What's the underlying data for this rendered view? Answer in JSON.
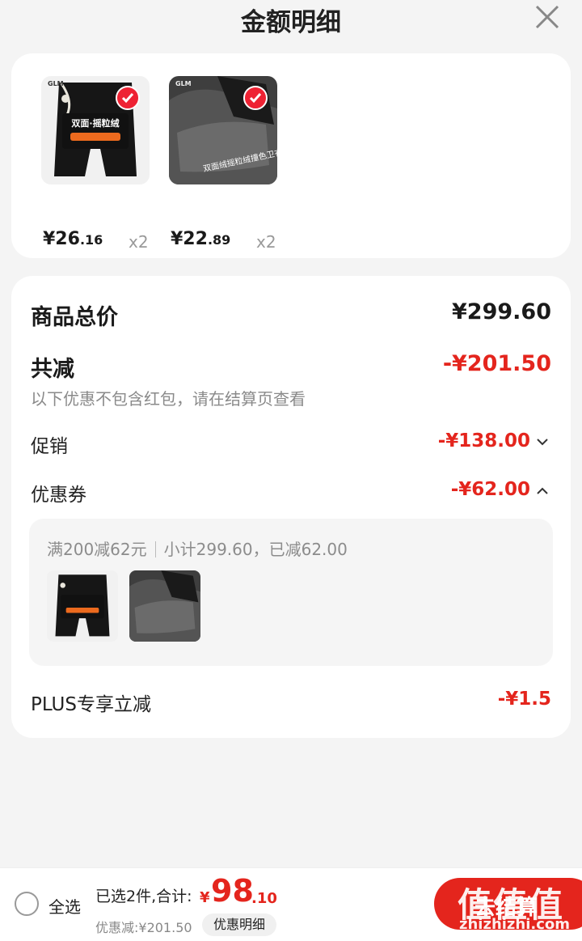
{
  "header": {
    "title": "金额明细"
  },
  "products": [
    {
      "thumb_text": "双面·摇粒绒",
      "brand": "GLM",
      "price_int": "¥26",
      "price_dec": ".16",
      "qty": "x2",
      "selected": true
    },
    {
      "thumb_text": "双面绒摇粒绒撞色卫衣",
      "brand": "GLM",
      "price_int": "¥22",
      "price_dec": ".89",
      "qty": "x2",
      "selected": true
    }
  ],
  "details": {
    "total_label": "商品总价",
    "total_value": "¥299.60",
    "discount_label": "共减",
    "discount_value": "-¥201.50",
    "note": "以下优惠不包含红包，请在结算页查看",
    "promo_label": "促销",
    "promo_value": "-¥138.00",
    "coupon_label": "优惠券",
    "coupon_value": "-¥62.00",
    "coupon_rule": "满200减62元",
    "coupon_sub": "小计299.60，已减62.00",
    "plus_label": "PLUS专享立减",
    "plus_value": "-¥1.5"
  },
  "bottom_bar": {
    "select_all": "全选",
    "summary": "已选2件,合计:",
    "total_symbol": "¥",
    "total_int": "98",
    "total_dec": ".10",
    "saved": "优惠减:¥201.50",
    "detail_button": "优惠明细",
    "checkout": "去结算"
  },
  "watermark": {
    "main": "值值值",
    "sub": "zhizhizhi.com"
  },
  "colors": {
    "accent": "#e4251d",
    "background": "#f4f4f4",
    "card": "#ffffff"
  }
}
